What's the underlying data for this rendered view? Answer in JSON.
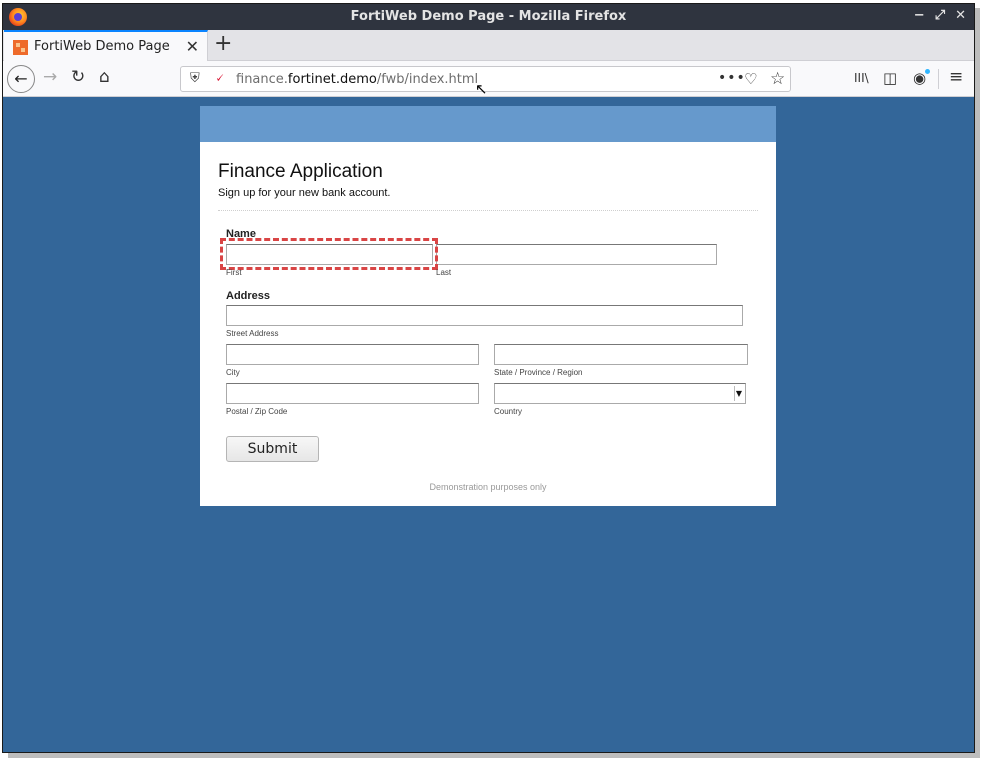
{
  "window": {
    "title": "FortiWeb Demo Page - Mozilla Firefox",
    "controls": [
      "−",
      "⤢",
      "✕"
    ]
  },
  "tab": {
    "title": "FortiWeb Demo Page",
    "close": "✕"
  },
  "newtab": "+",
  "nav": {
    "back": "←",
    "forward": "→",
    "reload": "↻",
    "home": "⌂"
  },
  "url": {
    "prefix": "finance.",
    "domain": "fortinet.demo",
    "path": "/fwb/index.html"
  },
  "urlbar_icons": {
    "more": "•••",
    "pocket": "♡",
    "star": "☆"
  },
  "toolbar_icons": {
    "library": "III\\",
    "sidebar": "◫",
    "account": "◉",
    "menu": "≡"
  },
  "form": {
    "title": "Finance Application",
    "subtitle": "Sign up for your new bank account.",
    "name_label": "Name",
    "first_label": "First",
    "last_label": "Last",
    "address_label": "Address",
    "street_label": "Street Address",
    "city_label": "City",
    "state_label": "State / Province / Region",
    "zip_label": "Postal / Zip Code",
    "country_label": "Country",
    "submit_label": "Submit",
    "footnote": "Demonstration purposes only"
  },
  "colors": {
    "page_background": "#336699",
    "form_header": "#6699cc",
    "titlebar": "#2f343f",
    "highlight": "#d94545"
  }
}
